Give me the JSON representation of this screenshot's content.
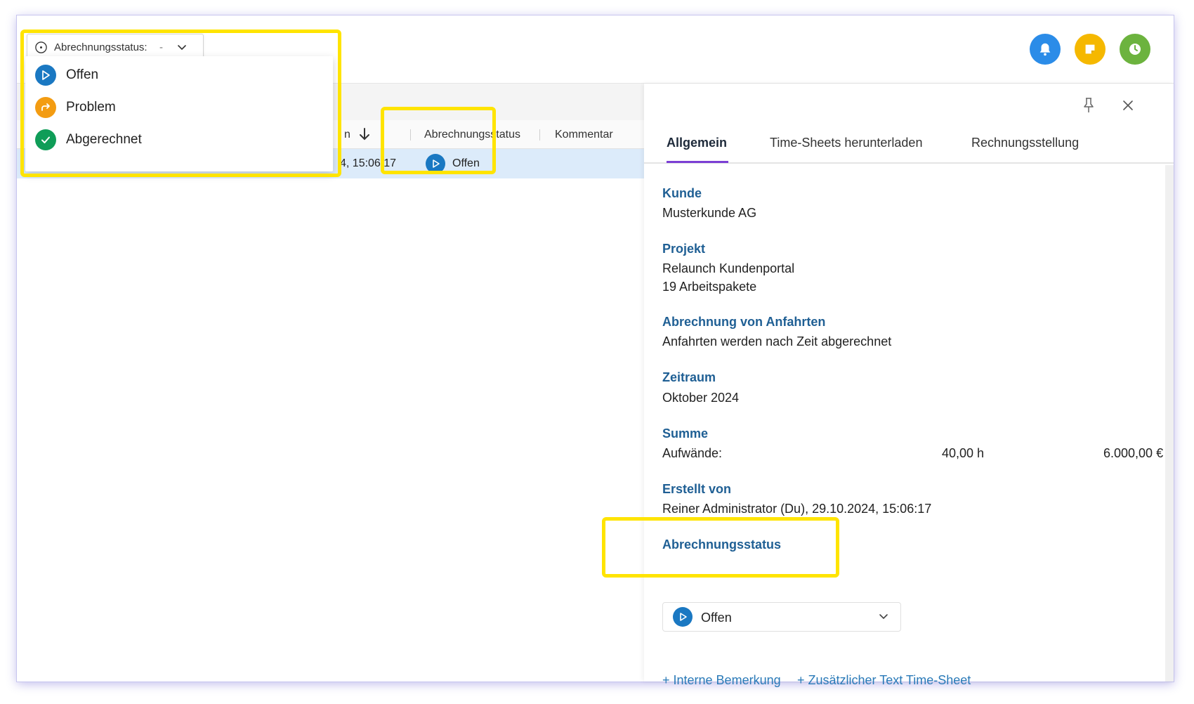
{
  "filter": {
    "label": "Abrechnungsstatus:",
    "value": "-",
    "options": [
      {
        "label": "Offen",
        "icon": "play-icon",
        "color": "#1a78c2"
      },
      {
        "label": "Problem",
        "icon": "redo-icon",
        "color": "#f39c12"
      },
      {
        "label": "Abgerechnet",
        "icon": "check-icon",
        "color": "#0f9d58"
      }
    ]
  },
  "topbar": {
    "icons": [
      {
        "name": "bell-icon",
        "color": "#2b8ce8"
      },
      {
        "name": "note-icon",
        "color": "#f5b800"
      },
      {
        "name": "clock-icon",
        "color": "#6cb33e"
      }
    ]
  },
  "list": {
    "columns": [
      {
        "label": "n"
      },
      {
        "label": "Abrechnungsstatus"
      },
      {
        "label": "Kommentar"
      }
    ],
    "rows": [
      {
        "date_fragment": "4, 15:06:17",
        "status": "Offen"
      }
    ]
  },
  "detail": {
    "tabs": [
      "Allgemein",
      "Time-Sheets herunterladen",
      "Rechnungsstellung"
    ],
    "active_tab": "Allgemein",
    "kunde_label": "Kunde",
    "kunde_value": "Musterkunde AG",
    "projekt_label": "Projekt",
    "projekt_value": "Relaunch Kundenportal",
    "projekt_pakete": "19 Arbeitspakete",
    "anfahrten_label": "Abrechnung von Anfahrten",
    "anfahrten_value": "Anfahrten werden nach Zeit abgerechnet",
    "zeitraum_label": "Zeitraum",
    "zeitraum_value": "Oktober 2024",
    "summe_label": "Summe",
    "summe_item": "Aufwände:",
    "summe_hours": "40,00 h",
    "summe_amount": "6.000,00 €",
    "erstellt_label": "Erstellt von",
    "erstellt_value": "Reiner Administrator (Du), 29.10.2024, 15:06:17",
    "status_label": "Abrechnungsstatus",
    "status_value": "Offen",
    "link_bemerkung": "+ Interne Bemerkung",
    "link_text": "+ Zusätzlicher Text Time-Sheet"
  },
  "colors": {
    "accent": "#7b3fd4",
    "label_blue": "#1f5f94",
    "link_blue": "#2a7ab8",
    "highlight": "#ffe400",
    "row_selected": "#dcebfa"
  }
}
